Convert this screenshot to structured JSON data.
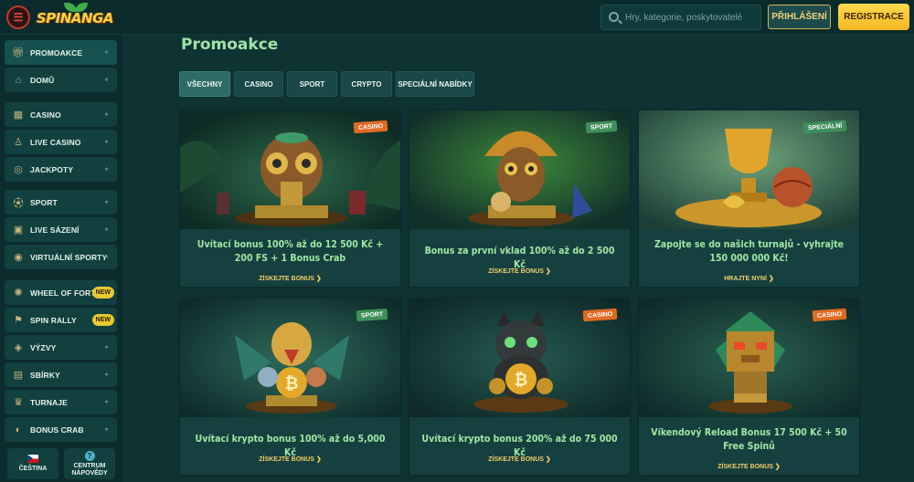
{
  "header": {
    "logo_text": "SPINANGA",
    "search_placeholder": "Hry, kategorie, poskytovatelé",
    "login_label": "PŘIHLÁŠENÍ",
    "register_label": "REGISTRACE"
  },
  "sidebar": {
    "items": [
      {
        "label": "PROMOAKCE",
        "icon": "gift-icon"
      },
      {
        "label": "DOMŮ",
        "icon": "home-icon"
      },
      {
        "label": "CASINO",
        "icon": "slot-machine-icon"
      },
      {
        "label": "LIVE CASINO",
        "icon": "dealer-icon"
      },
      {
        "label": "JACKPOTY",
        "icon": "coins-icon"
      },
      {
        "label": "SPORT",
        "icon": "soccer-ball-icon"
      },
      {
        "label": "LIVE SÁZENÍ",
        "icon": "live-betting-icon"
      },
      {
        "label": "VIRTUÁLNÍ SPORTY",
        "icon": "virtual-sports-icon"
      },
      {
        "label": "WHEEL OF FORTUNE",
        "icon": "wheel-icon",
        "badge": "NEW"
      },
      {
        "label": "SPIN RALLY",
        "icon": "rally-icon",
        "badge": "NEW"
      },
      {
        "label": "VÝZVY",
        "icon": "challenge-icon"
      },
      {
        "label": "SBÍRKY",
        "icon": "collection-icon"
      },
      {
        "label": "TURNAJE",
        "icon": "trophy-icon"
      },
      {
        "label": "BONUS CRAB",
        "icon": "crab-icon"
      }
    ],
    "language_label": "ČEŠTINA",
    "help_label_1": "CENTRUM",
    "help_label_2": "NÁPOVĚDY"
  },
  "main": {
    "title": "Promoakce",
    "tabs": [
      "VŠECHNY",
      "CASINO",
      "SPORT",
      "CRYPTO",
      "SPECIÁLNÍ NABÍDKY"
    ],
    "cards": [
      {
        "tag": "CASINO",
        "title": "Uvítací bonus 100% až do 12 500 Kč + 200 FS + 1 Bonus Crab",
        "cta": "ZÍSKEJTE BONUS ❯"
      },
      {
        "tag": "SPORT",
        "title": "Bonus za první vklad 100% až do 2 500 Kč",
        "cta": "ZÍSKEJTE BONUS ❯"
      },
      {
        "tag": "SPECIÁLNÍ",
        "title": "Zapojte se do našich turnajů - vyhrajte 150 000 000 Kč!",
        "cta": "HRAJTE NYNÍ ❯"
      },
      {
        "tag": "SPORT",
        "title": "Uvítací krypto bonus 100% až do 5,000 Kč",
        "cta": "ZÍSKEJTE BONUS ❯"
      },
      {
        "tag": "CASINO",
        "title": "Uvítací krypto bonus 200% až do 75 000 Kč",
        "cta": "ZÍSKEJTE BONUS ❯"
      },
      {
        "tag": "CASINO",
        "title": "Víkendový Reload Bonus 17 500 Kč + 50 Free Spinů",
        "cta": "ZÍSKEJTE BONUS ❯"
      }
    ]
  },
  "colors": {
    "background": "#0f3333",
    "accent_green": "#9fe8a5",
    "accent_gold": "#f2d06a",
    "register_yellow": "#f4b823",
    "casino_tag": "#e06a22",
    "sport_tag": "#3f8f5b"
  }
}
